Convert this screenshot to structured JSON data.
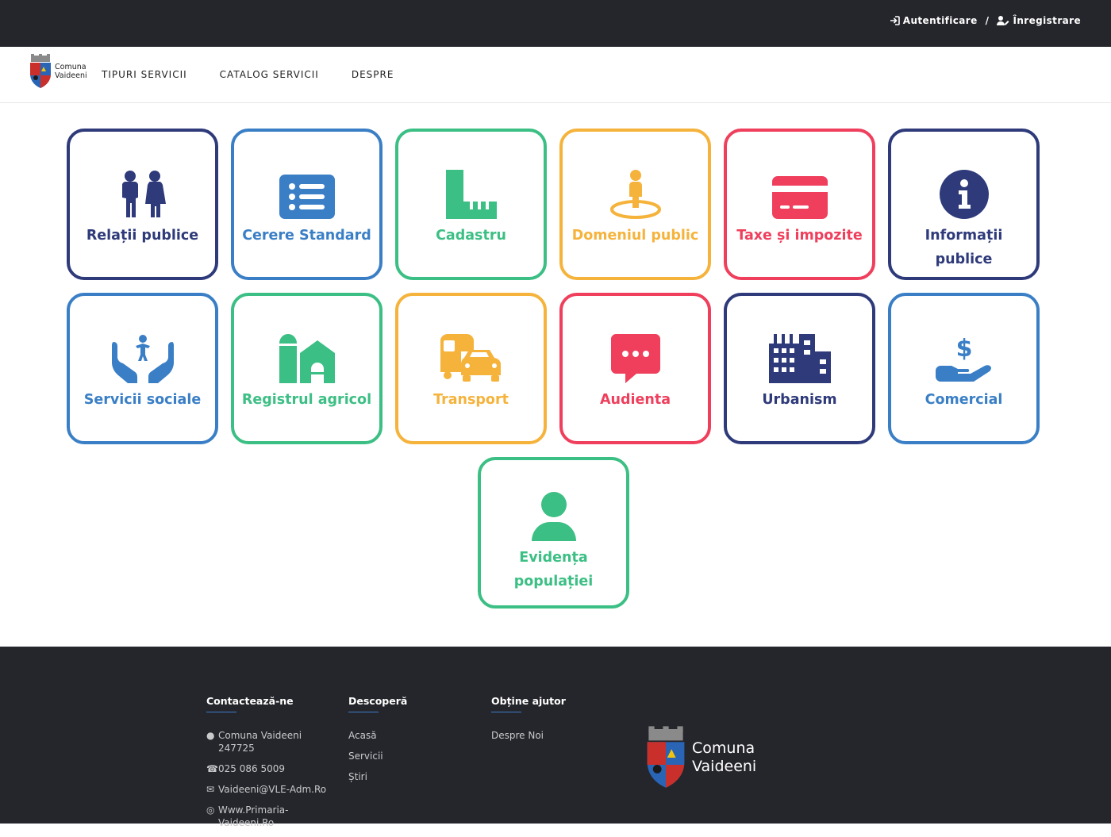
{
  "topbar": {
    "login_label": "Autentificare",
    "separator": "/",
    "register_label": "Înregistrare"
  },
  "brand": {
    "line1": "Comuna",
    "line2": "Vaideeni"
  },
  "nav": {
    "items": [
      "TIPURI SERVICII",
      "CATALOG SERVICII",
      "DESPRE"
    ]
  },
  "services": [
    {
      "label": "Relații publice",
      "icon": "restroom-icon",
      "color": "#2e3a7a"
    },
    {
      "label": "Cerere Standard",
      "icon": "list-icon",
      "color": "#3a7fc6"
    },
    {
      "label": "Cadastru",
      "icon": "ruler-icon",
      "color": "#3cbf84"
    },
    {
      "label": "Domeniul public",
      "icon": "street-view-icon",
      "color": "#f5b33c"
    },
    {
      "label": "Taxe și impozite",
      "icon": "credit-card-icon",
      "color": "#ef3f5c"
    },
    {
      "label": "Informații publice",
      "icon": "info-icon",
      "color": "#2e3a7a"
    },
    {
      "label": "Servicii sociale",
      "icon": "hands-child-icon",
      "color": "#3a7fc6"
    },
    {
      "label": "Registrul agricol",
      "icon": "farm-icon",
      "color": "#3cbf84"
    },
    {
      "label": "Transport",
      "icon": "shuttle-car-icon",
      "color": "#f5b33c"
    },
    {
      "label": "Audienta",
      "icon": "comment-dots-icon",
      "color": "#ef3f5c"
    },
    {
      "label": "Urbanism",
      "icon": "city-icon",
      "color": "#2e3a7a"
    },
    {
      "label": "Comercial",
      "icon": "hand-dollar-icon",
      "color": "#3a7fc6"
    },
    {
      "label": "Evidența populației",
      "icon": "user-icon",
      "color": "#3cbf84"
    }
  ],
  "footer": {
    "contact": {
      "title": "Contactează-ne",
      "address": "Comuna Vaideeni 247725",
      "phone": "025 086 5009",
      "email": "Vaideeni@VLE-Adm.Ro",
      "website": "Www.Primaria-Vaideeni.Ro"
    },
    "discover": {
      "title": "Descoperă",
      "items": [
        "Acasă",
        "Servicii",
        "Știri"
      ]
    },
    "help": {
      "title": "Obține ajutor",
      "items": [
        "Despre Noi"
      ]
    },
    "logo_line1": "Comuna",
    "logo_line2": "Vaideeni"
  }
}
